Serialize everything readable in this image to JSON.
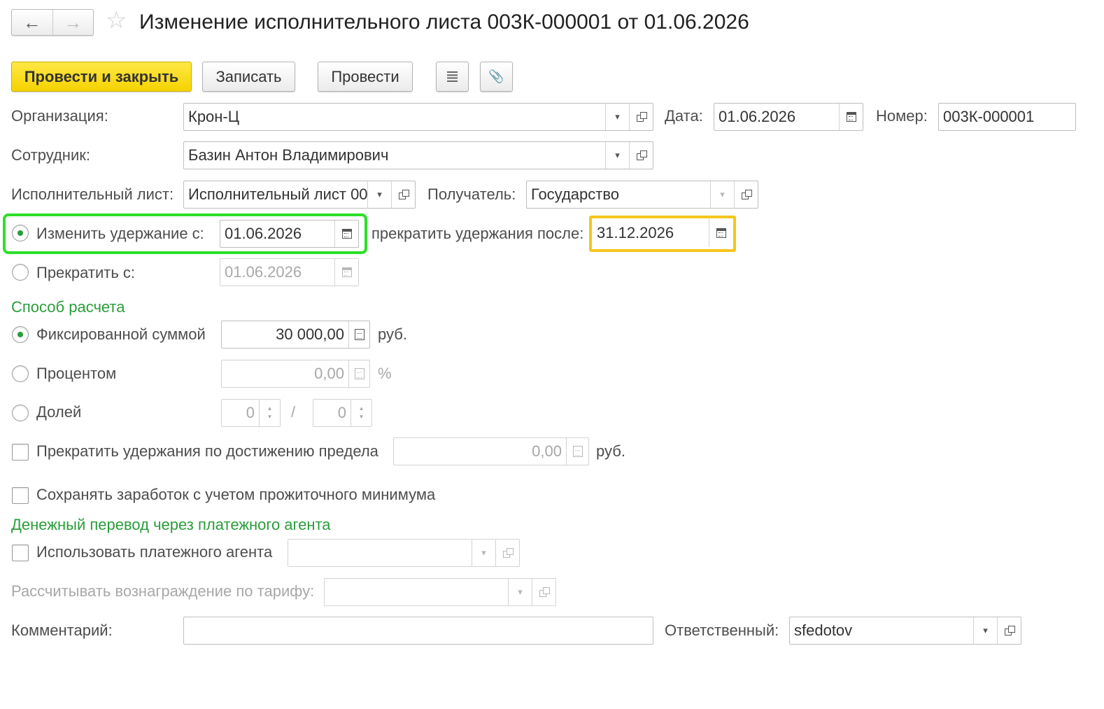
{
  "header": {
    "back_icon": "←",
    "forward_icon": "→",
    "star_icon": "☆",
    "title": "Изменение исполнительного листа 003К-000001 от 01.06.2026"
  },
  "toolbar": {
    "post_close": "Провести и закрыть",
    "save": "Записать",
    "post": "Провести",
    "report_icon": "≣",
    "attach_icon": "📎"
  },
  "form": {
    "organization": {
      "label": "Организация:",
      "value": "Крон-Ц"
    },
    "date": {
      "label": "Дата:",
      "value": "01.06.2026"
    },
    "number": {
      "label": "Номер:",
      "value": "003К-000001"
    },
    "employee": {
      "label": "Сотрудник:",
      "value": "Базин Антон Владимирович"
    },
    "writ": {
      "label": "Исполнительный лист:",
      "value": "Исполнительный лист 00"
    },
    "recipient": {
      "label": "Получатель:",
      "value": "Государство"
    },
    "change_from": {
      "label": "Изменить удержание с:",
      "value": "01.06.2026",
      "checked": true
    },
    "stop_after": {
      "label": "прекратить удержания после:",
      "value": "31.12.2026"
    },
    "stop_from": {
      "label": "Прекратить с:",
      "value": "01.06.2026",
      "checked": false
    },
    "calc_section": "Способ расчета",
    "fixed": {
      "label": "Фиксированной суммой",
      "value": "30 000,00",
      "unit": "руб.",
      "checked": true
    },
    "percent": {
      "label": "Процентом",
      "value": "0,00",
      "unit": "%",
      "checked": false
    },
    "share": {
      "label": "Долей",
      "num": "0",
      "sep": "/",
      "den": "0",
      "checked": false
    },
    "limit": {
      "label": "Прекратить удержания по достижению предела",
      "value": "0,00",
      "unit": "руб.",
      "checked": false
    },
    "keep_min": {
      "label": "Сохранять заработок с учетом прожиточного минимума",
      "checked": false
    },
    "transfer_section": "Денежный перевод через платежного агента",
    "use_agent": {
      "label": "Использовать платежного агента",
      "value": "",
      "checked": false
    },
    "tariff": {
      "label": "Рассчитывать вознаграждение по тарифу:",
      "value": ""
    },
    "comment": {
      "label": "Комментарий:",
      "value": ""
    },
    "responsible": {
      "label": "Ответственный:",
      "value": "sfedotov"
    }
  },
  "icons": {
    "dropdown": "▾",
    "spin_up": "▴",
    "spin_down": "▾"
  },
  "colors": {
    "accent_green": "#2a9d3b",
    "primary_button": "#f5d300",
    "highlight_green": "#2be02a",
    "highlight_yellow": "#f6c51d"
  }
}
